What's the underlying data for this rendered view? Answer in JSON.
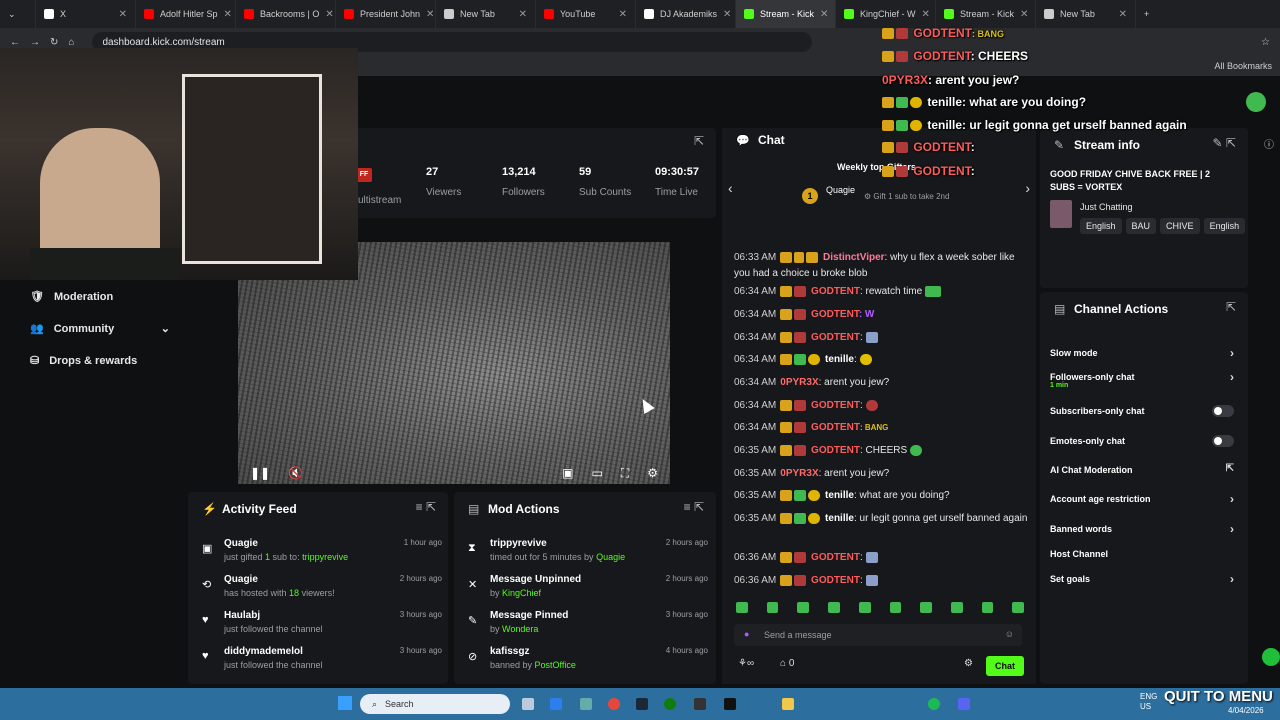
{
  "browser": {
    "tabs": [
      {
        "label": "X",
        "color": "#ffffff"
      },
      {
        "label": "Adolf Hitler Sp",
        "color": "#ff0000"
      },
      {
        "label": "Backrooms | O",
        "color": "#ff0000"
      },
      {
        "label": "President John",
        "color": "#ff0000"
      },
      {
        "label": "New Tab",
        "color": "#cccccc"
      },
      {
        "label": "YouTube",
        "color": "#ff0000"
      },
      {
        "label": "DJ Akademiks",
        "color": "#ffffff"
      },
      {
        "label": "Stream - Kick",
        "color": "#53fc18"
      },
      {
        "label": "KingChief - W",
        "color": "#53fc18"
      },
      {
        "label": "Stream - Kick",
        "color": "#53fc18"
      },
      {
        "label": "New Tab",
        "color": "#cccccc"
      }
    ],
    "url": "dashboard.kick.com/stream",
    "bookmarks_label": "All Bookmarks"
  },
  "stats": {
    "partial_label": "ultistream",
    "viewers": "27",
    "viewers_label": "Viewers",
    "followers": "13,214",
    "followers_label": "Followers",
    "subs": "59",
    "subs_label": "Sub Counts",
    "time": "09:30:57",
    "time_label": "Time Live"
  },
  "sidebar": {
    "items": [
      {
        "label": "Moderation"
      },
      {
        "label": "Community"
      },
      {
        "label": "Drops & rewards"
      }
    ]
  },
  "activity": {
    "title": "Activity Feed",
    "items": [
      {
        "name": "Quagie",
        "sub_prefix": "just gifted ",
        "sub_count": "1",
        "sub_mid": " sub to: ",
        "sub_target": "trippyrevive",
        "time": "1 hour ago"
      },
      {
        "name": "Quagie",
        "sub_prefix": "has hosted with ",
        "sub_count": "18",
        "sub_mid": " viewers!",
        "sub_target": "",
        "time": "2 hours ago"
      },
      {
        "name": "Haulabj",
        "sub_prefix": "just followed the channel",
        "sub_count": "",
        "sub_mid": "",
        "sub_target": "",
        "time": "3 hours ago"
      },
      {
        "name": "diddymademelol",
        "sub_prefix": "just followed the channel",
        "sub_count": "",
        "sub_mid": "",
        "sub_target": "",
        "time": "3 hours ago"
      }
    ]
  },
  "mod": {
    "title": "Mod Actions",
    "items": [
      {
        "name": "trippyrevive",
        "sub": "timed out for 5 minutes by ",
        "by": "Quagie",
        "time": "2 hours ago"
      },
      {
        "name": "Message Unpinned",
        "sub": "by ",
        "by": "KingChief",
        "time": "2 hours ago"
      },
      {
        "name": "Message Pinned",
        "sub": "by ",
        "by": "Wondera",
        "time": "3 hours ago"
      },
      {
        "name": "kafissgz",
        "sub": "banned by ",
        "by": "PostOffice",
        "time": "4 hours ago"
      }
    ]
  },
  "chat": {
    "title": "Chat",
    "gifter_heading": "Weekly top Gifters",
    "gifter_rank": "1",
    "gifter_name": "Quagie",
    "gift_hint": "Gift 1 sub to take 2nd",
    "messages": [
      {
        "time": "06:33 AM",
        "user": "DistinctViper",
        "text": ": why u flex a week sober like you had a choice u broke blob"
      },
      {
        "time": "06:34 AM",
        "user": "GODTENT",
        "text": ": rewatch time"
      },
      {
        "time": "06:34 AM",
        "user": "GODTENT",
        "text": ": W"
      },
      {
        "time": "06:34 AM",
        "user": "GODTENT",
        "text": ":"
      },
      {
        "time": "06:34 AM",
        "user": "tenille",
        "text": ":"
      },
      {
        "time": "06:34 AM",
        "user": "0PYR3X",
        "text": ": arent you jew?"
      },
      {
        "time": "06:34 AM",
        "user": "GODTENT",
        "text": ":"
      },
      {
        "time": "06:34 AM",
        "user": "GODTENT",
        "text": ": BANG"
      },
      {
        "time": "06:35 AM",
        "user": "GODTENT",
        "text": ": CHEERS"
      },
      {
        "time": "06:35 AM",
        "user": "0PYR3X",
        "text": ": arent you jew?"
      },
      {
        "time": "06:35 AM",
        "user": "tenille",
        "text": ": what are you doing?"
      },
      {
        "time": "06:35 AM",
        "user": "tenille",
        "text": ": ur legit gonna get urself banned again"
      },
      {
        "time": "06:36 AM",
        "user": "GODTENT",
        "text": ":"
      },
      {
        "time": "06:36 AM",
        "user": "GODTENT",
        "text": ":"
      }
    ],
    "input_placeholder": "Send a message",
    "footer_count": "0",
    "send_label": "Chat"
  },
  "streaminfo": {
    "title": "Stream info",
    "stream_title": "GOOD FRIDAY CHIVE BACK FREE | 2 SUBS = VORTEX",
    "category": "Just Chatting",
    "tags": [
      "English",
      "BAU",
      "CHIVE",
      "English"
    ]
  },
  "actions": {
    "title": "Channel Actions",
    "items": [
      {
        "label": "Slow mode",
        "sub": ""
      },
      {
        "label": "Followers-only chat",
        "sub": "1 min"
      },
      {
        "label": "Subscribers-only chat",
        "sub": ""
      },
      {
        "label": "Emotes-only chat",
        "sub": ""
      },
      {
        "label": "AI Chat Moderation",
        "sub": ""
      },
      {
        "label": "Account age restriction",
        "sub": ""
      },
      {
        "label": "Banned words",
        "sub": ""
      },
      {
        "label": "Host Channel",
        "sub": ""
      },
      {
        "label": "Set goals",
        "sub": ""
      }
    ]
  },
  "overlay": {
    "lines": [
      {
        "user": "GODTENT",
        "text": ": BANG"
      },
      {
        "user": "GODTENT",
        "text": ": CHEERS"
      },
      {
        "user": "0PYR3X",
        "text": ": arent you jew?"
      },
      {
        "user": "tenille",
        "text": ": what are you doing?"
      },
      {
        "user": "tenille",
        "text": ": ur legit gonna get urself banned again"
      },
      {
        "user": "GODTENT",
        "text": ":"
      },
      {
        "user": "GODTENT",
        "text": ":"
      }
    ],
    "quit_label": "QUIT TO MENU"
  },
  "taskbar": {
    "search_label": "Search",
    "lang": "ENG",
    "region": "US",
    "date": "4/04/2026"
  }
}
